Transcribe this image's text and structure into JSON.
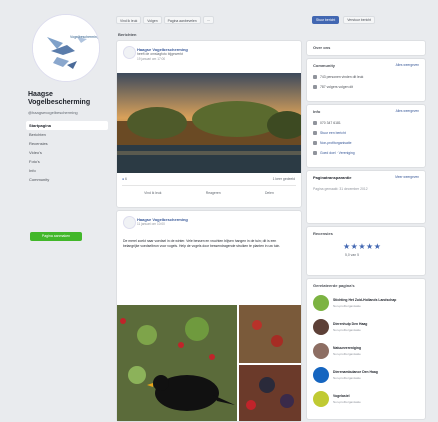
{
  "page": {
    "name": "Haagse Vogelbescherming",
    "handle": "@haagsevogelbescherming",
    "logo_text": "Vogelbescherming"
  },
  "nav": {
    "items": [
      "Startpagina",
      "Berichten",
      "Recensies",
      "Video's",
      "Foto's",
      "Info",
      "Community"
    ],
    "cta_label": "Pagina aanmaken"
  },
  "actions": {
    "like": "Vind ik leuk",
    "follow": "Volgen",
    "recommend": "Pagina aanbevelen",
    "more": "···"
  },
  "feed": {
    "section_title": "Berichten",
    "post1": {
      "author": "Haagse Vogelbescherming",
      "subtitle": "heeft de omslagfoto bijgewerkt",
      "meta": "19 januari om 17:00",
      "reactions": "6",
      "shares": "1 keer gedeeld"
    },
    "post2": {
      "author": "Haagse Vogelbescherming",
      "meta": "11 januari om 10:00",
      "text": "De merel zoekt naar voedsel in de winter. Vele bessen en vruchten blijven hangen in de tuin; dit is een belangrijke voedselbron voor vogels. Help de vogels door bessendragende struiken te planten in uw tuin."
    },
    "bar": [
      "Vind ik leuk",
      "Reageren",
      "Delen"
    ]
  },
  "right": {
    "btn_message": "Stuur bericht",
    "btn_other": "Verstuur bericht",
    "card_about": {
      "title": "Over ons"
    },
    "community": {
      "title": "Community",
      "link": "Alles weergeven",
      "rows": [
        "743 personen vinden dit leuk",
        "787 volgers volgen dit"
      ]
    },
    "info": {
      "title": "Info",
      "link": "Alles weergeven",
      "rows": [
        "070 347 6181",
        "Stuur een bericht",
        "Non-profitorganisatie",
        "Goed doel · Vereniging"
      ]
    },
    "transparency": {
      "title": "Paginatransparantie",
      "link": "Meer weergeven",
      "text": "Pagina gemaakt: 31 december 2012"
    },
    "reviews": {
      "title": "Recensies",
      "stars": "★★★★★",
      "rating": "5,0 van 5"
    },
    "related": {
      "title": "Gerelateerde pagina's",
      "items": [
        {
          "name": "Stichting Het Zuid-Hollands Landschap",
          "sub": "Non-profitorganisatie",
          "color": "#7cb342"
        },
        {
          "name": "Dierenhulp Den Haag",
          "sub": "Non-profitorganisatie",
          "color": "#5d4037"
        },
        {
          "name": "Natuurvereniging",
          "sub": "Non-profitorganisatie",
          "color": "#8d6e63"
        },
        {
          "name": "Dierenambulance Den Haag",
          "sub": "Non-profitorganisatie",
          "color": "#1565c0"
        },
        {
          "name": "Vogelasiel",
          "sub": "Non-profitorganisatie",
          "color": "#c0ca33"
        }
      ]
    }
  }
}
